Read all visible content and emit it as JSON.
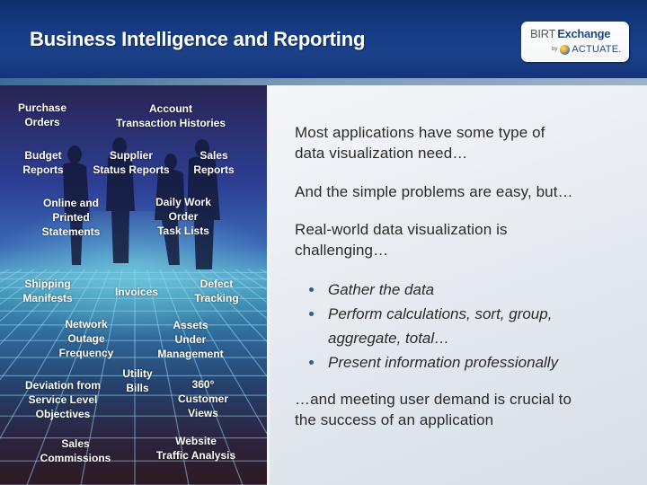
{
  "header": {
    "title": "Business Intelligence and Reporting",
    "logo": {
      "brand_light": "BIRT",
      "brand_bold": "Exchange",
      "by": "by",
      "company": "ACTUATE."
    }
  },
  "image_panel": {
    "labels": [
      {
        "name": "purchase-orders",
        "lines": [
          "Purchase",
          "Orders"
        ]
      },
      {
        "name": "account-transaction-histories",
        "lines": [
          "Account",
          "Transaction Histories"
        ]
      },
      {
        "name": "budget-reports",
        "lines": [
          "Budget",
          "Reports"
        ]
      },
      {
        "name": "supplier-status-reports",
        "lines": [
          "Supplier",
          "Status Reports"
        ]
      },
      {
        "name": "sales-reports",
        "lines": [
          "Sales",
          "Reports"
        ]
      },
      {
        "name": "online-printed-statements",
        "lines": [
          "Online and",
          "Printed",
          "Statements"
        ]
      },
      {
        "name": "daily-work-order-task-lists",
        "lines": [
          "Daily Work",
          "Order",
          "Task Lists"
        ]
      },
      {
        "name": "shipping-manifests",
        "lines": [
          "Shipping",
          "Manifests"
        ]
      },
      {
        "name": "invoices",
        "lines": [
          "Invoices"
        ]
      },
      {
        "name": "defect-tracking",
        "lines": [
          "Defect",
          "Tracking"
        ]
      },
      {
        "name": "network-outage-frequency",
        "lines": [
          "Network",
          "Outage",
          "Frequency"
        ]
      },
      {
        "name": "assets-under-management",
        "lines": [
          "Assets",
          "Under",
          "Management"
        ]
      },
      {
        "name": "utility-bills",
        "lines": [
          "Utility",
          "Bills"
        ]
      },
      {
        "name": "deviation-service-level",
        "lines": [
          "Deviation from",
          "Service Level",
          "Objectives"
        ]
      },
      {
        "name": "customer-views-360",
        "lines": [
          "360°",
          "Customer",
          "Views"
        ]
      },
      {
        "name": "sales-commissions",
        "lines": [
          "Sales",
          "Commissions"
        ]
      },
      {
        "name": "website-traffic-analysis",
        "lines": [
          "Website",
          "Traffic Analysis"
        ]
      }
    ]
  },
  "text_panel": {
    "para1": [
      "Most applications have some type of",
      "data visualization need…"
    ],
    "para2": [
      "And the simple problems are easy, but…"
    ],
    "para3": [
      "Real-world data visualization is",
      "challenging…"
    ],
    "bullets": [
      [
        "Gather the data"
      ],
      [
        "Perform calculations, sort, group,",
        "aggregate, total…"
      ],
      [
        "Present information professionally"
      ]
    ],
    "para4": [
      "…and meeting user demand is crucial to",
      "the success of an application"
    ]
  },
  "colors": {
    "header_bg": "#173d86",
    "title_text": "#ffffff",
    "body_text": "#2b2b2b",
    "bullet": "#2e5f8a",
    "logo_blue": "#1e4a8c"
  }
}
